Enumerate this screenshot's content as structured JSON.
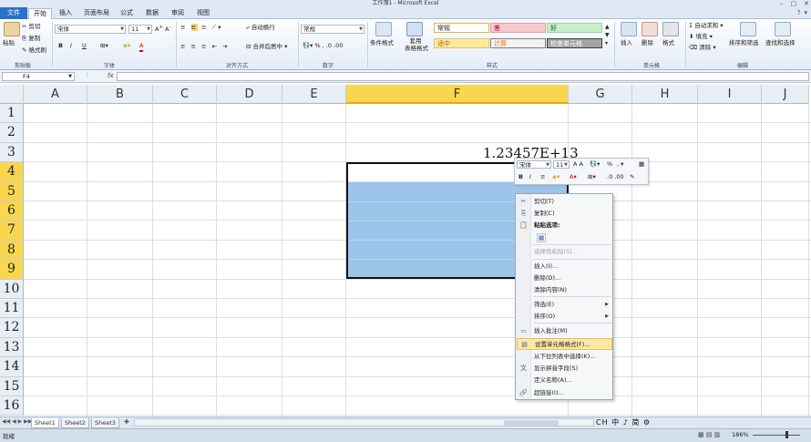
{
  "window": {
    "title": "工作簿1 - Microsoft Excel",
    "controls": [
      "–",
      "▢",
      "✕"
    ]
  },
  "tabs": [
    {
      "label": "文件",
      "active": false,
      "file": true
    },
    {
      "label": "开始",
      "active": true
    },
    {
      "label": "插入"
    },
    {
      "label": "页面布局"
    },
    {
      "label": "公式"
    },
    {
      "label": "数据"
    },
    {
      "label": "审阅"
    },
    {
      "label": "视图"
    }
  ],
  "ribbon": {
    "clipboard": {
      "paste": "粘贴",
      "cut": "剪切",
      "copy": "复制",
      "format_painter": "格式刷",
      "label": "剪贴板"
    },
    "font": {
      "name": "宋体",
      "size": "11",
      "bold": "B",
      "italic": "I",
      "underline": "U",
      "font_color": "A",
      "label": "字体"
    },
    "alignment": {
      "wrap": "自动换行",
      "merge": "合并后居中",
      "label": "对齐方式"
    },
    "number": {
      "format": "常规",
      "percent": "%",
      "comma": ",",
      "label": "数字"
    },
    "styles": {
      "conditional": "条件格式",
      "table": "套用\n表格格式",
      "cells": [
        {
          "text": "常规",
          "bg": "#ffffff",
          "color": "#222",
          "border": "#e0b64c"
        },
        {
          "text": "差",
          "bg": "#f9c7ce",
          "color": "#9c0006",
          "border": "#d9a2aa"
        },
        {
          "text": "好",
          "bg": "#c6efce",
          "color": "#006100",
          "border": "#9fd1a8"
        },
        {
          "text": "适中",
          "bg": "#ffeb9c",
          "color": "#9c6500",
          "border": "#d6c27f"
        },
        {
          "text": "计算",
          "bg": "#f2f2f2",
          "color": "#fa7d00",
          "border": "#7f7f7f"
        },
        {
          "text": "检查单元格",
          "bg": "#a5a5a5",
          "color": "#ffffff",
          "border": "#3f3f3f"
        }
      ],
      "label": "样式"
    },
    "cells": {
      "insert": "插入",
      "delete": "删除",
      "format": "格式",
      "label": "单元格"
    },
    "editing": {
      "autosum": "自动求和",
      "fill": "填充",
      "clear": "清除",
      "sort": "排序和筛选",
      "find": "查找和选择",
      "label": "编辑"
    }
  },
  "formula_bar": {
    "name_box": "F4",
    "fx": "fx",
    "content": ""
  },
  "grid": {
    "columns": [
      "A",
      "B",
      "C",
      "D",
      "E",
      "F",
      "G",
      "H",
      "I",
      "J"
    ],
    "selected_column": "F",
    "rows": [
      "1",
      "2",
      "3",
      "4",
      "5",
      "6",
      "7",
      "8",
      "9",
      "10",
      "11",
      "12",
      "13",
      "14",
      "15",
      "16"
    ],
    "selected_rows": [
      "4",
      "5",
      "6",
      "7",
      "8",
      "9"
    ],
    "cell_value": "1.23457E+13"
  },
  "mini_toolbar": {
    "font": "宋体",
    "size": "11",
    "percent": "%"
  },
  "context_menu": [
    {
      "label": "剪切(T)",
      "icon": "cut-icon",
      "glyph": "✂"
    },
    {
      "label": "复制(C)",
      "icon": "copy-icon",
      "glyph": "⎘"
    },
    {
      "label": "粘贴选项:",
      "icon": "paste-icon",
      "glyph": "📋",
      "bold": true
    },
    {
      "label": "",
      "icon": "paste-option-icon",
      "glyph": "▦"
    },
    {
      "label": "选择性粘贴(S)...",
      "disabled": true
    },
    {
      "label": "插入(I)..."
    },
    {
      "label": "删除(D)..."
    },
    {
      "label": "清除内容(N)"
    },
    {
      "label": "筛选(E)",
      "submenu": true
    },
    {
      "label": "排序(O)",
      "submenu": true
    },
    {
      "label": "插入批注(M)",
      "icon": "comment-icon",
      "glyph": "▭"
    },
    {
      "label": "设置单元格格式(F)...",
      "icon": "format-cells-icon",
      "glyph": "▤",
      "highlight": true
    },
    {
      "label": "从下拉列表中选择(K)..."
    },
    {
      "label": "显示拼音字段(S)",
      "icon": "phonetic-icon",
      "glyph": "文"
    },
    {
      "label": "定义名称(A)..."
    },
    {
      "label": "超链接(I)...",
      "icon": "hyperlink-icon",
      "glyph": "🔗"
    }
  ],
  "sheets": [
    {
      "name": "Sheet1",
      "active": true
    },
    {
      "name": "Sheet2"
    },
    {
      "name": "Sheet3"
    }
  ],
  "status": {
    "ready": "就绪",
    "zoom": "186%",
    "ime": "CH 中 ♪ 简 ⚙"
  }
}
